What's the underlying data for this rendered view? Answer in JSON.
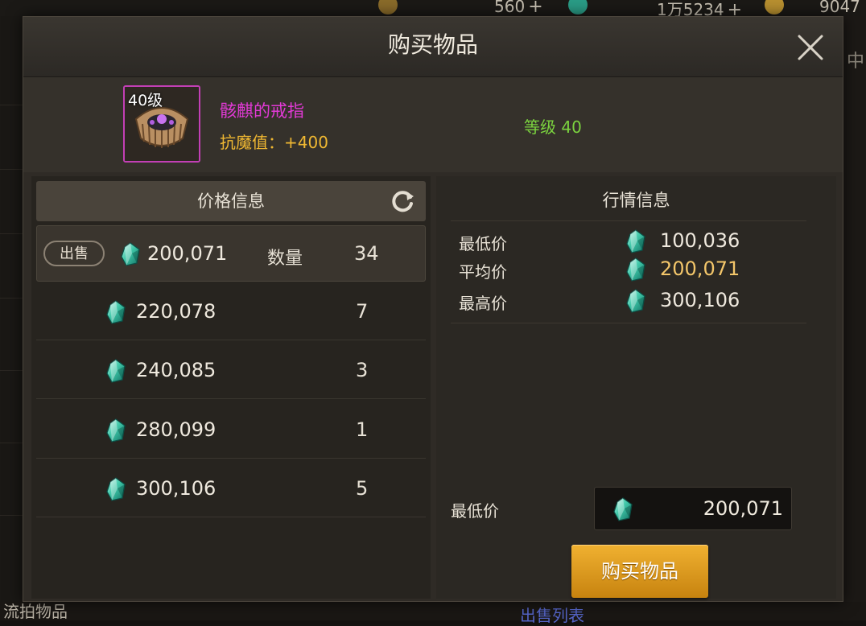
{
  "background": {
    "resources": [
      {
        "value": "560",
        "icon": "moon-icon"
      },
      {
        "value": "1万5234",
        "icon": "gem-icon"
      },
      {
        "value": "9047",
        "icon": "gold-coin-icon"
      }
    ],
    "right_edge_char": "中",
    "bottom_left_text": "流拍物品",
    "bottom_right_text": "出售列表"
  },
  "dialog": {
    "title": "购买物品",
    "close_icon": "close-icon",
    "item": {
      "level_badge": "40级",
      "name": "骸麒的戒指",
      "stat": "抗魔值：+400",
      "required_level": "等级 40",
      "rarity_color": "#c23fb5"
    },
    "price_panel": {
      "title": "价格信息",
      "refresh_icon": "refresh-icon",
      "sell_tag": "出售",
      "quantity_label": "数量",
      "rows": [
        {
          "price": "200,071",
          "qty": "34",
          "selected": true
        },
        {
          "price": "220,078",
          "qty": "7",
          "selected": false
        },
        {
          "price": "240,085",
          "qty": "3",
          "selected": false
        },
        {
          "price": "280,099",
          "qty": "1",
          "selected": false
        },
        {
          "price": "300,106",
          "qty": "5",
          "selected": false
        }
      ]
    },
    "market_panel": {
      "title": "行情信息",
      "stats": [
        {
          "label": "最低价",
          "value": "100,036",
          "color": "#efe9de"
        },
        {
          "label": "平均价",
          "value": "200,071",
          "color": "#f3c66a"
        },
        {
          "label": "最高价",
          "value": "300,106",
          "color": "#efe9de"
        }
      ],
      "min_price_label": "最低价",
      "min_price_value": "200,071",
      "buy_button": "购买物品"
    },
    "currency_icon": "gem-icon",
    "accent_color": "#e0a025"
  }
}
